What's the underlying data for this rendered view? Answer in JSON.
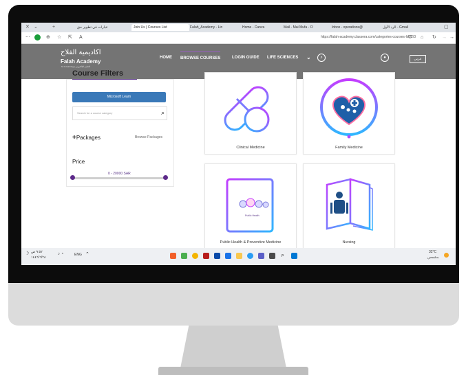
{
  "browser": {
    "tabs": [
      {
        "label": "عبارات في تطوير حق",
        "active": false
      },
      {
        "label": "Join Us | Courses List",
        "active": true
      },
      {
        "label": "Falah_Academy - Lin",
        "active": false
      },
      {
        "label": "Home - Canva",
        "active": false
      },
      {
        "label": "Mail - Mai Mufa - O",
        "active": false
      },
      {
        "label": "Inbox - operations@",
        "active": false
      },
      {
        "label": "الرد الأول - Gmail",
        "active": false
      }
    ],
    "url": "https://falah-academy.classera.com/categories-courses-list/2/3"
  },
  "site": {
    "logo_ar": "اكاديمية الفلاح",
    "logo_en": "Falah Academy",
    "logo_sub": "for E-learning | للتعليم الإلكتروني",
    "nav": {
      "home": "HOME",
      "browse": "BROWSE COURSES",
      "login": "LOGIN GUIDE",
      "life": "LIFE SCIENCES"
    },
    "lang": "عربي"
  },
  "filters": {
    "title": "Course Filters",
    "microsoft_learn": "Microsoft Learn",
    "search_placeholder": "Search for a course category",
    "packages": "Packages",
    "browse_packages": "Browse Packages",
    "price": "Price",
    "price_range": "0 - 20000 SAR",
    "price_min": 0,
    "price_max": 20000
  },
  "courses": [
    {
      "label": "Clinical Medicine",
      "icon": "capsule-plus-icon"
    },
    {
      "label": "Family Medicine",
      "icon": "heart-family-icon"
    },
    {
      "label": "Public Health & Preventive Medicine",
      "icon": "book-public-health-icon"
    },
    {
      "label": "Nursing",
      "icon": "nursing-book-icon"
    }
  ],
  "public_health_book_text": "Public Health",
  "taskbar": {
    "time": "٩:٥٢ ص",
    "date": "١٤٤٦/٦/٢٨",
    "lang": "ENG",
    "temp": "32°C",
    "weather": "مشمس"
  },
  "colors": {
    "header_bg": "#747474",
    "accent_purple": "#5d3a8a",
    "button_blue": "#3a79b8",
    "gradient_start": "#c43dff",
    "gradient_end": "#2fb7ff"
  }
}
